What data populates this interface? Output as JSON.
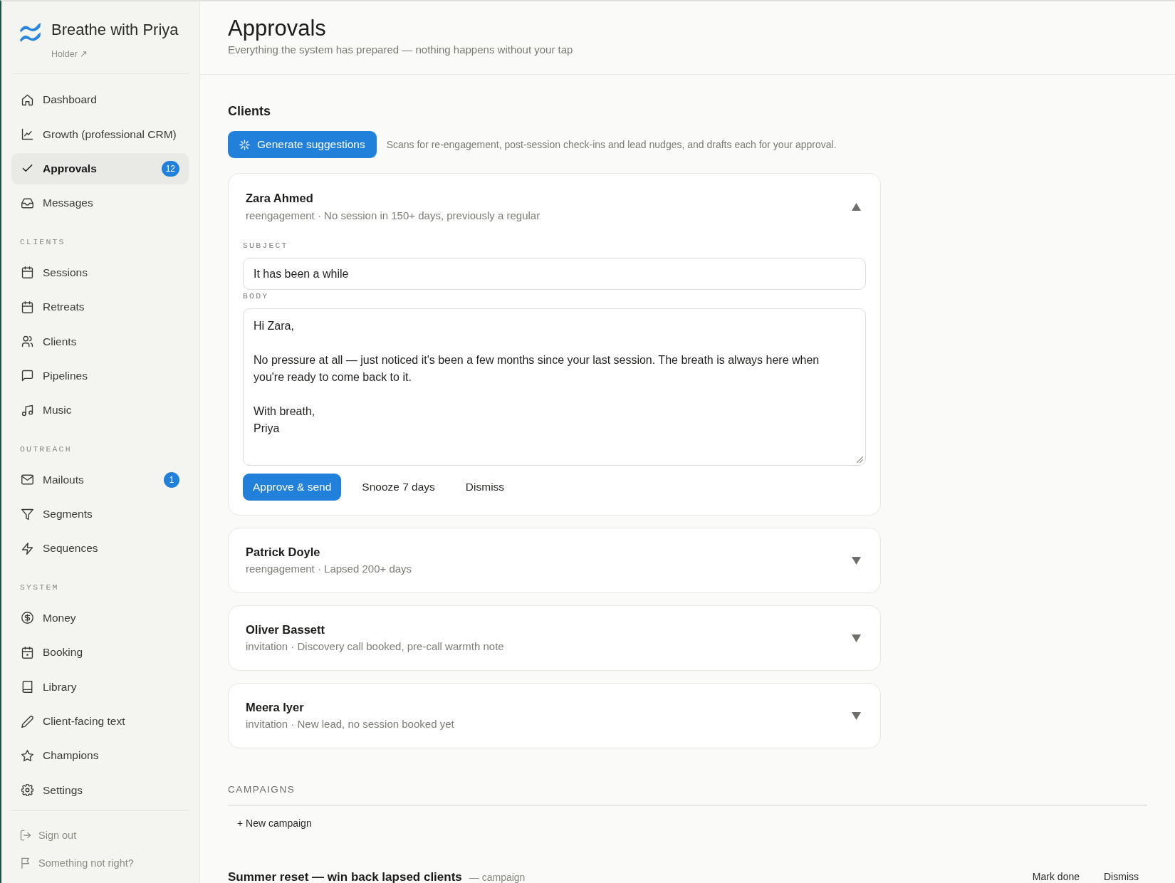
{
  "sidebar": {
    "brand": {
      "name": "Breathe with Priya",
      "link": "Holder ↗"
    },
    "groups": [
      {
        "items": [
          {
            "label": "Dashboard",
            "selected": false
          },
          {
            "label": "Growth (professional CRM)",
            "selected": false
          },
          {
            "label": "Approvals",
            "selected": true,
            "badge": "12"
          },
          {
            "label": "Messages",
            "selected": false
          }
        ]
      },
      {
        "heading": "CLIENTS",
        "items": [
          {
            "label": "Sessions",
            "selected": false
          },
          {
            "label": "Retreats",
            "selected": false
          },
          {
            "label": "Clients",
            "selected": false
          },
          {
            "label": "Pipelines",
            "selected": false
          },
          {
            "label": "Music",
            "selected": false
          }
        ]
      },
      {
        "heading": "OUTREACH",
        "items": [
          {
            "label": "Mailouts",
            "selected": false,
            "badge": "1"
          },
          {
            "label": "Segments",
            "selected": false
          },
          {
            "label": "Sequences",
            "selected": false
          }
        ]
      },
      {
        "heading": "SYSTEM",
        "items": [
          {
            "label": "Money",
            "selected": false
          },
          {
            "label": "Booking",
            "selected": false
          },
          {
            "label": "Library",
            "selected": false
          },
          {
            "label": "Client-facing text",
            "selected": false
          },
          {
            "label": "Champions",
            "selected": false
          },
          {
            "label": "Settings",
            "selected": false
          }
        ]
      }
    ],
    "footer_links": [
      "Sign out",
      "Something not right?"
    ]
  },
  "header": {
    "title": "Approvals",
    "subtitle": "Everything the system has prepared — nothing happens without your tap"
  },
  "clients": {
    "title": "Clients",
    "generate_button": "Generate suggestions",
    "generate_hint": "Scans for re-engagement, post-session check-ins and lead nudges, and drafts each for your approval.",
    "suggestions": [
      {
        "name": "Zara Ahmed",
        "meta": "reengagement · No session in 150+ days, previously a regular",
        "expanded": true,
        "subject_label": "SUBJECT",
        "subject": "It has been a while",
        "body_label": "BODY",
        "body": "Hi Zara,\n\nNo pressure at all — just noticed it's been a few months since your last session. The breath is always here when you're ready to come back to it.\n\nWith breath,\nPriya",
        "actions": [
          {
            "label": "Approve & send",
            "kind": "primary"
          },
          {
            "label": "Snooze 7 days",
            "kind": "plain"
          },
          {
            "label": "Dismiss",
            "kind": "plain"
          }
        ]
      },
      {
        "name": "Patrick Doyle",
        "meta": "reengagement · Lapsed 200+ days",
        "expanded": false
      },
      {
        "name": "Oliver Bassett",
        "meta": "invitation · Discovery call booked, pre-call warmth note",
        "expanded": false
      },
      {
        "name": "Meera Iyer",
        "meta": "invitation · New lead, no session booked yet",
        "expanded": false
      }
    ]
  },
  "campaigns": {
    "heading": "CAMPAIGNS",
    "new_button": "+ New campaign",
    "items": [
      {
        "title": "Summer reset — win back lapsed clients",
        "tag": "— campaign",
        "actions": [
          "Mark done",
          "Dismiss"
        ]
      }
    ]
  }
}
